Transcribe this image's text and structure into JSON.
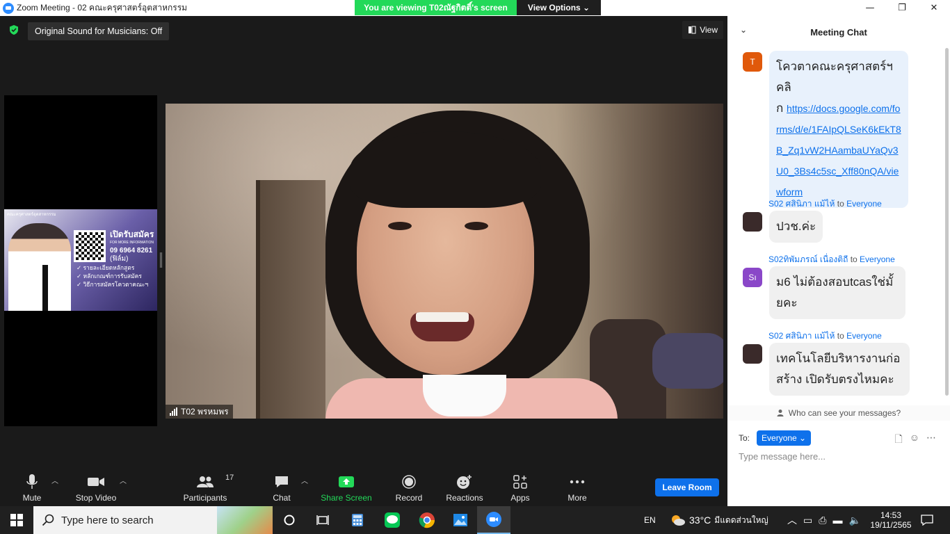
{
  "window": {
    "title": "Zoom Meeting - 02 คณะครุศาสตร์อุตสาหกรรม",
    "controls": {
      "minimize": "—",
      "restore": "❐",
      "close": "✕"
    }
  },
  "banner": {
    "viewing_text": "You are viewing T02ณัฐกิตติ์'s screen",
    "view_options": "View Options ⌄"
  },
  "meeting": {
    "original_sound": "Original Sound for Musicians: Off",
    "view_label": "View",
    "main_participant": "T02 พรหมพร"
  },
  "poster": {
    "top_text": "คณะครุศาสตร์อุตสาหกรรม",
    "open_title": "เปิดรับสมัคร",
    "info": "FOR MORE INFORMATION",
    "phone": "09 6964 8261",
    "contact_name": "(ฟิล์ม)",
    "items": [
      "รายละเอียดหลักสูตร",
      "หลักเกณฑ์การรับสมัคร",
      "วิธีการสมัครโควตาคณะฯ"
    ]
  },
  "toolbar": {
    "mute": "Mute",
    "stop_video": "Stop Video",
    "participants": "Participants",
    "participants_count": "17",
    "chat": "Chat",
    "share_screen": "Share Screen",
    "record": "Record",
    "reactions": "Reactions",
    "apps": "Apps",
    "more": "More",
    "leave": "Leave Room"
  },
  "chat": {
    "header": "Meeting Chat",
    "messages": [
      {
        "avatar": "T",
        "avatar_color": "#e0590b",
        "text": "โควตาคณะครุศาสตร์ฯ คลิ",
        "prefix": "ก",
        "link": "https://docs.google.com/forms/d/e/1FAIpQLSeK6kEkT8B_Zq1vW2HAambaUYaQv3U0_3Bs4c5sc_Xff80nQA/viewform"
      },
      {
        "sender": "S02 ศสินิภา แม้ไห้",
        "to": "to",
        "recipient": "Everyone",
        "text": "ปวช.ค่ะ"
      },
      {
        "sender": "S02ทิพัมภรณ์ เนื่องติถี",
        "to": "to",
        "recipient": "Everyone",
        "avatar": "Sı",
        "avatar_color": "#8a47c8",
        "text": "ม6 ไม่ต้องสอบtcasใช่มั้ยคะ"
      },
      {
        "sender": "S02 ศสินิภา แม้ไห้",
        "to": "to",
        "recipient": "Everyone",
        "text": "เทคโนโลยีบริหารงานก่อสร้าง เปิดรับตรงไหมคะ"
      }
    ],
    "who_can_see": "Who can see your messages?",
    "to_label": "To:",
    "to_value": "Everyone ⌄",
    "input_placeholder": "Type message here..."
  },
  "taskbar": {
    "search_placeholder": "Type here to search",
    "lang": "EN",
    "temperature": "33°C",
    "weather": "มีแดดส่วนใหญ่",
    "time": "14:53",
    "date": "19/11/2565",
    "colors": {
      "line": "#06c755",
      "zoom": "#2d8cff"
    }
  }
}
